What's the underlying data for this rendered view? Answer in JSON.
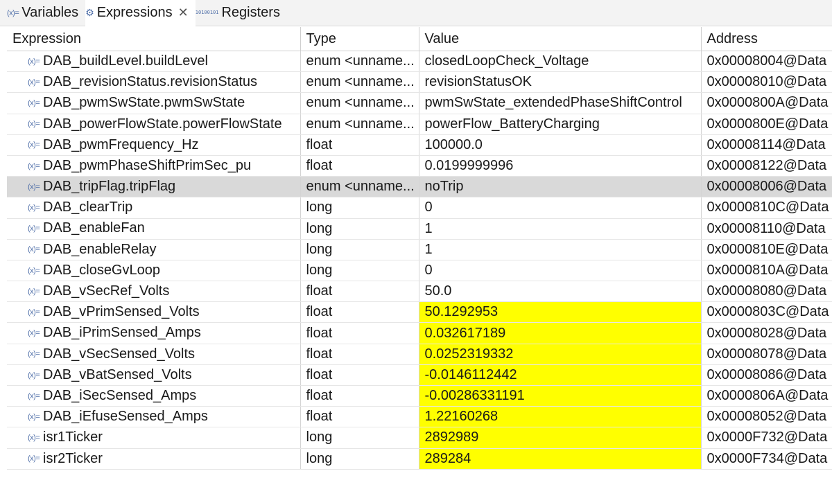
{
  "tabs": [
    {
      "label": "Variables",
      "icon": "variables-icon"
    },
    {
      "label": "Expressions",
      "icon": "expressions-icon",
      "active": true
    },
    {
      "label": "Registers",
      "icon": "registers-icon"
    }
  ],
  "columns": [
    "Expression",
    "Type",
    "Value",
    "Address"
  ],
  "highlight_color": "#ffff00",
  "rows": [
    {
      "expression": "DAB_buildLevel.buildLevel",
      "type": "enum <unname...",
      "value": "closedLoopCheck_Voltage",
      "address": "0x00008004@Data"
    },
    {
      "expression": "DAB_revisionStatus.revisionStatus",
      "type": "enum <unname...",
      "value": "revisionStatusOK",
      "address": "0x00008010@Data"
    },
    {
      "expression": "DAB_pwmSwState.pwmSwState",
      "type": "enum <unname...",
      "value": "pwmSwState_extendedPhaseShiftControl",
      "address": "0x0000800A@Data"
    },
    {
      "expression": "DAB_powerFlowState.powerFlowState",
      "type": "enum <unname...",
      "value": "powerFlow_BatteryCharging",
      "address": "0x0000800E@Data"
    },
    {
      "expression": "DAB_pwmFrequency_Hz",
      "type": "float",
      "value": "100000.0",
      "address": "0x00008114@Data"
    },
    {
      "expression": "DAB_pwmPhaseShiftPrimSec_pu",
      "type": "float",
      "value": "0.0199999996",
      "address": "0x00008122@Data"
    },
    {
      "expression": "DAB_tripFlag.tripFlag",
      "type": "enum <unname...",
      "value": "noTrip",
      "address": "0x00008006@Data",
      "selected": true
    },
    {
      "expression": "DAB_clearTrip",
      "type": "long",
      "value": "0",
      "address": "0x0000810C@Data"
    },
    {
      "expression": "DAB_enableFan",
      "type": "long",
      "value": "1",
      "address": "0x00008110@Data"
    },
    {
      "expression": "DAB_enableRelay",
      "type": "long",
      "value": "1",
      "address": "0x0000810E@Data"
    },
    {
      "expression": "DAB_closeGvLoop",
      "type": "long",
      "value": "0",
      "address": "0x0000810A@Data"
    },
    {
      "expression": "DAB_vSecRef_Volts",
      "type": "float",
      "value": "50.0",
      "address": "0x00008080@Data"
    },
    {
      "expression": "DAB_vPrimSensed_Volts",
      "type": "float",
      "value": "50.1292953",
      "address": "0x0000803C@Data",
      "changed": true
    },
    {
      "expression": "DAB_iPrimSensed_Amps",
      "type": "float",
      "value": "0.032617189",
      "address": "0x00008028@Data",
      "changed": true
    },
    {
      "expression": "DAB_vSecSensed_Volts",
      "type": "float",
      "value": "0.0252319332",
      "address": "0x00008078@Data",
      "changed": true
    },
    {
      "expression": "DAB_vBatSensed_Volts",
      "type": "float",
      "value": "-0.0146112442",
      "address": "0x00008086@Data",
      "changed": true
    },
    {
      "expression": "DAB_iSecSensed_Amps",
      "type": "float",
      "value": "-0.00286331191",
      "address": "0x0000806A@Data",
      "changed": true
    },
    {
      "expression": "DAB_iEfuseSensed_Amps",
      "type": "float",
      "value": "1.22160268",
      "address": "0x00008052@Data",
      "changed": true
    },
    {
      "expression": "isr1Ticker",
      "type": "long",
      "value": "2892989",
      "address": "0x0000F732@Data",
      "changed": true
    },
    {
      "expression": "isr2Ticker",
      "type": "long",
      "value": "289284",
      "address": "0x0000F734@Data",
      "changed": true
    }
  ]
}
